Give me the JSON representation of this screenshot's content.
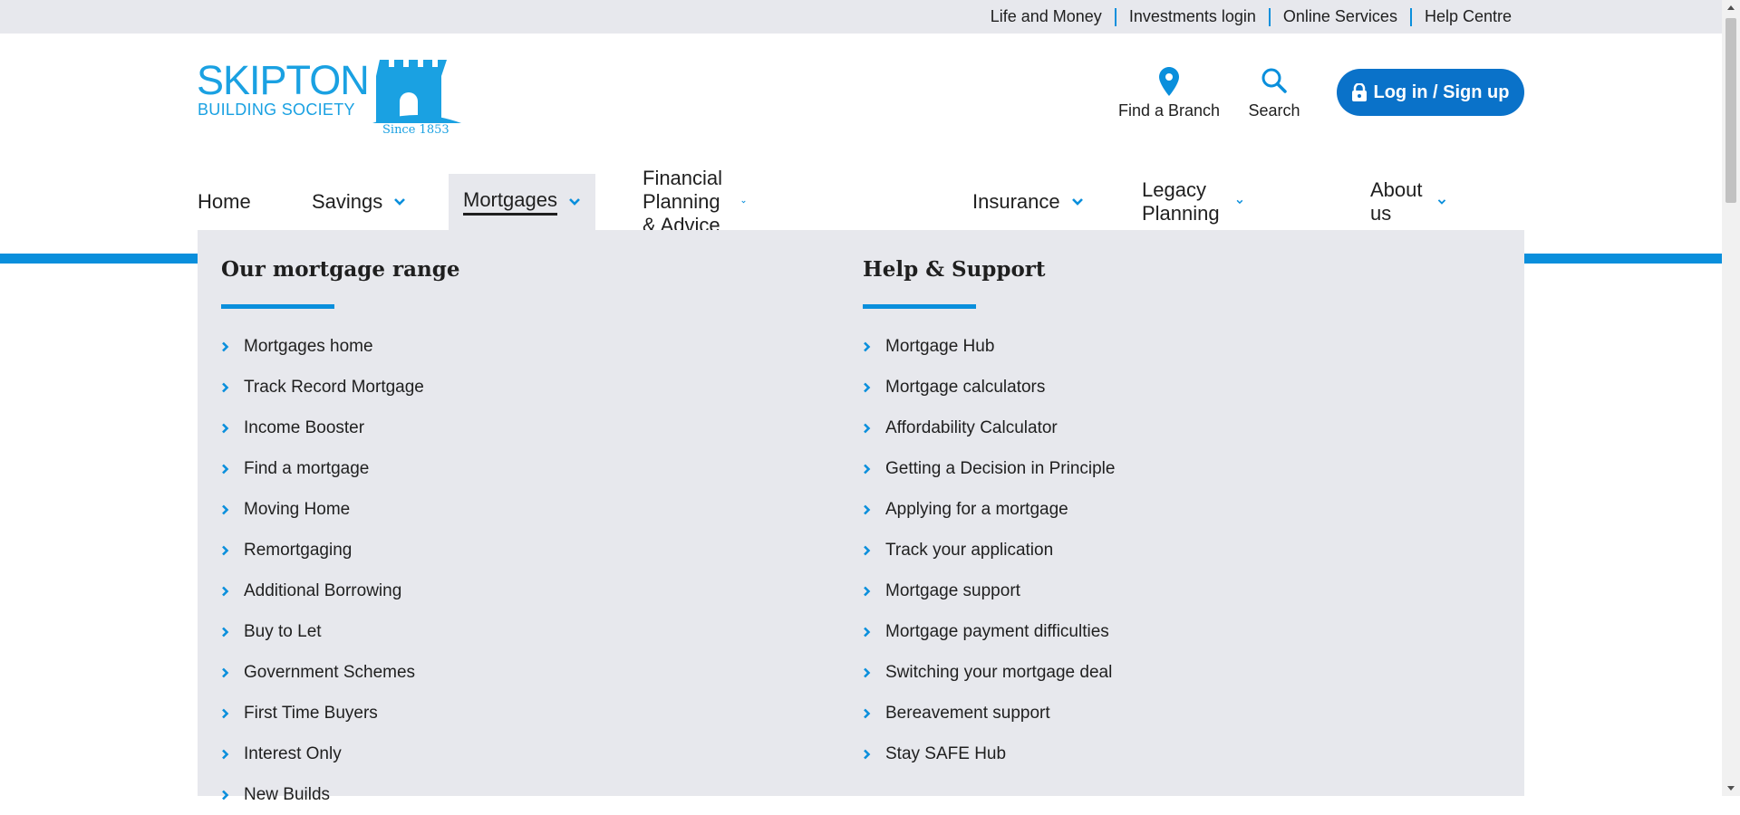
{
  "utility": {
    "links": [
      "Life and Money",
      "Investments login",
      "Online Services",
      "Help Centre"
    ]
  },
  "logo": {
    "line1": "SKIPTON",
    "line2": "BUILDING SOCIETY",
    "since": "Since 1853"
  },
  "header": {
    "find_branch": "Find a Branch",
    "search": "Search",
    "login": "Log in / Sign up"
  },
  "nav": {
    "items": [
      {
        "label": "Home",
        "dropdown": false
      },
      {
        "label": "Savings",
        "dropdown": true
      },
      {
        "label": "Mortgages",
        "dropdown": true,
        "active": true
      },
      {
        "label": "Financial Planning & Advice",
        "dropdown": true
      },
      {
        "label": "Insurance",
        "dropdown": true
      },
      {
        "label": "Legacy Planning",
        "dropdown": true
      },
      {
        "label": "About us",
        "dropdown": true
      }
    ]
  },
  "mega_menu": {
    "left": {
      "heading": "Our mortgage range",
      "links": [
        "Mortgages home",
        "Track Record Mortgage",
        "Income Booster",
        "Find a mortgage",
        "Moving Home",
        "Remortgaging",
        "Additional Borrowing",
        "Buy to Let",
        "Government Schemes",
        "First Time Buyers",
        "Interest Only",
        "New Builds"
      ]
    },
    "right": {
      "heading": "Help & Support",
      "links": [
        "Mortgage Hub",
        "Mortgage calculators",
        "Affordability Calculator",
        "Getting a Decision in Principle",
        "Applying for a mortgage",
        "Track your application",
        "Mortgage support",
        "Mortgage payment difficulties",
        "Switching your mortgage deal",
        "Bereavement support",
        "Stay SAFE Hub"
      ]
    }
  },
  "colors": {
    "brand_blue": "#1aa1e2",
    "accent_blue": "#0a8fdc",
    "button_blue": "#0a72c9",
    "menu_bg": "#e7e8ed"
  }
}
